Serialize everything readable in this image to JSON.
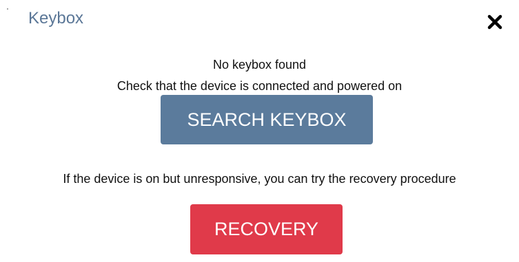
{
  "dialog": {
    "title": "Keybox",
    "close_icon": "close-icon",
    "messages": {
      "no_keybox": "No keybox found",
      "check_device": "Check that the device is connected and powered on",
      "recovery_hint": "If the device is on but unresponsive, you can try the recovery procedure"
    },
    "buttons": {
      "search_label": "SEARCH KEYBOX",
      "recovery_label": "RECOVERY"
    }
  },
  "colors": {
    "title": "#5b7797",
    "search_button": "#5b7b9c",
    "recovery_button": "#e03a4a",
    "text": "#111111"
  }
}
